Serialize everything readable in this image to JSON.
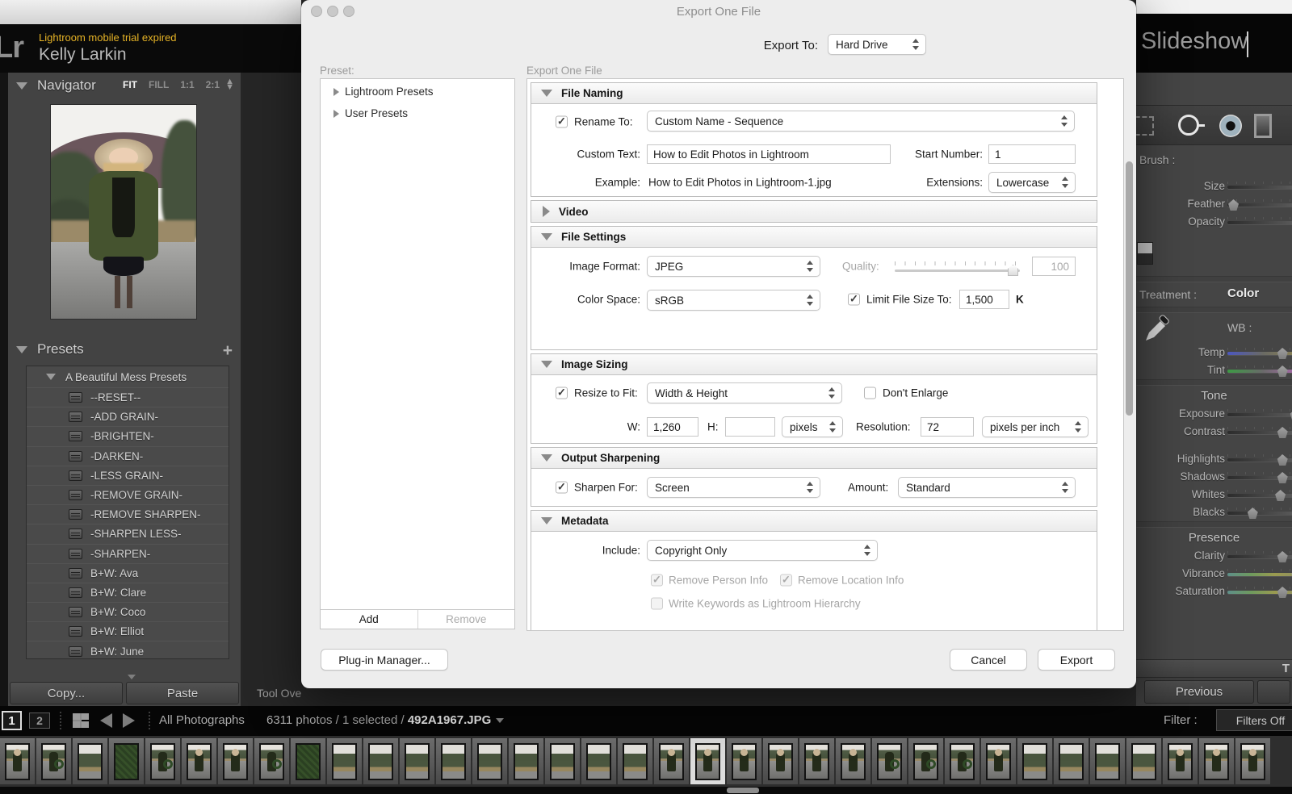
{
  "app": {
    "logo": "Lr",
    "trial_notice": "Lightroom mobile trial expired",
    "user_name": "Kelly Larkin",
    "module": "Slideshow",
    "tool_overlay_partial": "Tool Ove",
    "accent_yellow": "#e7b426"
  },
  "navigator": {
    "title": "Navigator",
    "modes": [
      "FIT",
      "FILL",
      "1:1",
      "2:1"
    ],
    "active_mode": "FIT"
  },
  "presets_panel": {
    "title": "Presets",
    "add_icon": "+",
    "group": "A Beautiful Mess Presets",
    "items": [
      "--RESET--",
      "-ADD GRAIN-",
      "-BRIGHTEN-",
      "-DARKEN-",
      "-LESS GRAIN-",
      "-REMOVE GRAIN-",
      "-REMOVE SHARPEN-",
      "-SHARPEN LESS-",
      "-SHARPEN-",
      "B+W: Ava",
      "B+W: Clare",
      "B+W: Coco",
      "B+W: Elliot",
      "B+W: June"
    ],
    "copy": "Copy...",
    "paste": "Paste"
  },
  "dialog": {
    "title": "Export One File",
    "export_to_label": "Export To:",
    "export_to_value": "Hard Drive",
    "preset_label": "Preset:",
    "preset_tree": [
      "Lightroom Presets",
      "User Presets"
    ],
    "add": "Add",
    "remove": "Remove",
    "pane_title": "Export One File",
    "file_naming": {
      "title": "File Naming",
      "rename_label": "Rename To:",
      "rename_value": "Custom Name - Sequence",
      "custom_text_label": "Custom Text:",
      "custom_text_value": "How to Edit Photos in Lightroom",
      "start_label": "Start Number:",
      "start_value": "1",
      "example_label": "Example:",
      "example_value": "How to Edit Photos in Lightroom-1.jpg",
      "extensions_label": "Extensions:",
      "extensions_value": "Lowercase"
    },
    "video_title": "Video",
    "file_settings": {
      "title": "File Settings",
      "format_label": "Image Format:",
      "format_value": "JPEG",
      "quality_label": "Quality:",
      "quality_value": "100",
      "colorspace_label": "Color Space:",
      "colorspace_value": "sRGB",
      "limit_label": "Limit File Size To:",
      "limit_value": "1,500",
      "limit_unit": "K"
    },
    "image_sizing": {
      "title": "Image Sizing",
      "resize_label": "Resize to Fit:",
      "resize_value": "Width & Height",
      "dont_enlarge": "Don't Enlarge",
      "w_label": "W:",
      "w_value": "1,260",
      "h_label": "H:",
      "h_value": "",
      "unit": "pixels",
      "res_label": "Resolution:",
      "res_value": "72",
      "res_unit": "pixels per inch"
    },
    "output_sharpening": {
      "title": "Output Sharpening",
      "sharpen_label": "Sharpen For:",
      "sharpen_value": "Screen",
      "amount_label": "Amount:",
      "amount_value": "Standard"
    },
    "metadata": {
      "title": "Metadata",
      "include_label": "Include:",
      "include_value": "Copyright Only",
      "person": "Remove Person Info",
      "location": "Remove Location Info",
      "keywords": "Write Keywords as Lightroom Hierarchy"
    },
    "plugin_manager": "Plug-in Manager...",
    "cancel": "Cancel",
    "export": "Export"
  },
  "right_panel": {
    "brush_label": "Brush :",
    "brush_sliders": [
      {
        "name": "Size",
        "thumb_pct": null,
        "track": "plain"
      },
      {
        "name": "Feather",
        "thumb_pct": 8,
        "track": "plain"
      },
      {
        "name": "Opacity",
        "thumb_pct": null,
        "track": "plain"
      }
    ],
    "treatment_label": "Treatment :",
    "treatment_value": "Color",
    "wb_label": "WB :",
    "wb_sliders": [
      {
        "name": "Temp",
        "thumb_pct": 77,
        "track": "temp"
      },
      {
        "name": "Tint",
        "thumb_pct": 77,
        "track": "tint"
      }
    ],
    "tone_label": "Tone",
    "tone_sliders_upper": [
      {
        "name": "Exposure",
        "thumb_pct": 95,
        "track": "plain"
      },
      {
        "name": "Contrast",
        "thumb_pct": 77,
        "track": "plain"
      }
    ],
    "tone_sliders_lower": [
      {
        "name": "Highlights",
        "thumb_pct": 77,
        "track": "plain"
      },
      {
        "name": "Shadows",
        "thumb_pct": 77,
        "track": "plain"
      },
      {
        "name": "Whites",
        "thumb_pct": 74,
        "track": "plain"
      },
      {
        "name": "Blacks",
        "thumb_pct": 35,
        "track": "plain"
      }
    ],
    "presence_label": "Presence",
    "presence_sliders": [
      {
        "name": "Clarity",
        "thumb_pct": 77,
        "track": "plain"
      },
      {
        "name": "Vibrance",
        "thumb_pct": 97,
        "track": "vib"
      },
      {
        "name": "Saturation",
        "thumb_pct": 77,
        "track": "vib"
      }
    ],
    "next_panel_partial": "T",
    "previous": "Previous"
  },
  "bottom_bar": {
    "window1": "1",
    "window2": "2",
    "source": "All Photographs",
    "count_text": "6311 photos / 1 selected / ",
    "filename": "492A1967.JPG",
    "filter_label": "Filter :",
    "filter_value": "Filters Off"
  },
  "filmstrip": {
    "selected_index": 19,
    "cells": [
      "portrait",
      "wreath",
      "trees",
      "closeup",
      "wreath",
      "portrait",
      "portrait",
      "wreath",
      "closeup",
      "trees",
      "trees",
      "trees",
      "trees",
      "trees",
      "trees",
      "trees",
      "trees",
      "trees",
      "portrait",
      "portrait",
      "portrait",
      "portrait",
      "portrait",
      "portrait",
      "wreath",
      "wreath",
      "wreath",
      "portrait",
      "trees",
      "trees",
      "trees",
      "trees",
      "portrait",
      "portrait",
      "portrait"
    ]
  }
}
